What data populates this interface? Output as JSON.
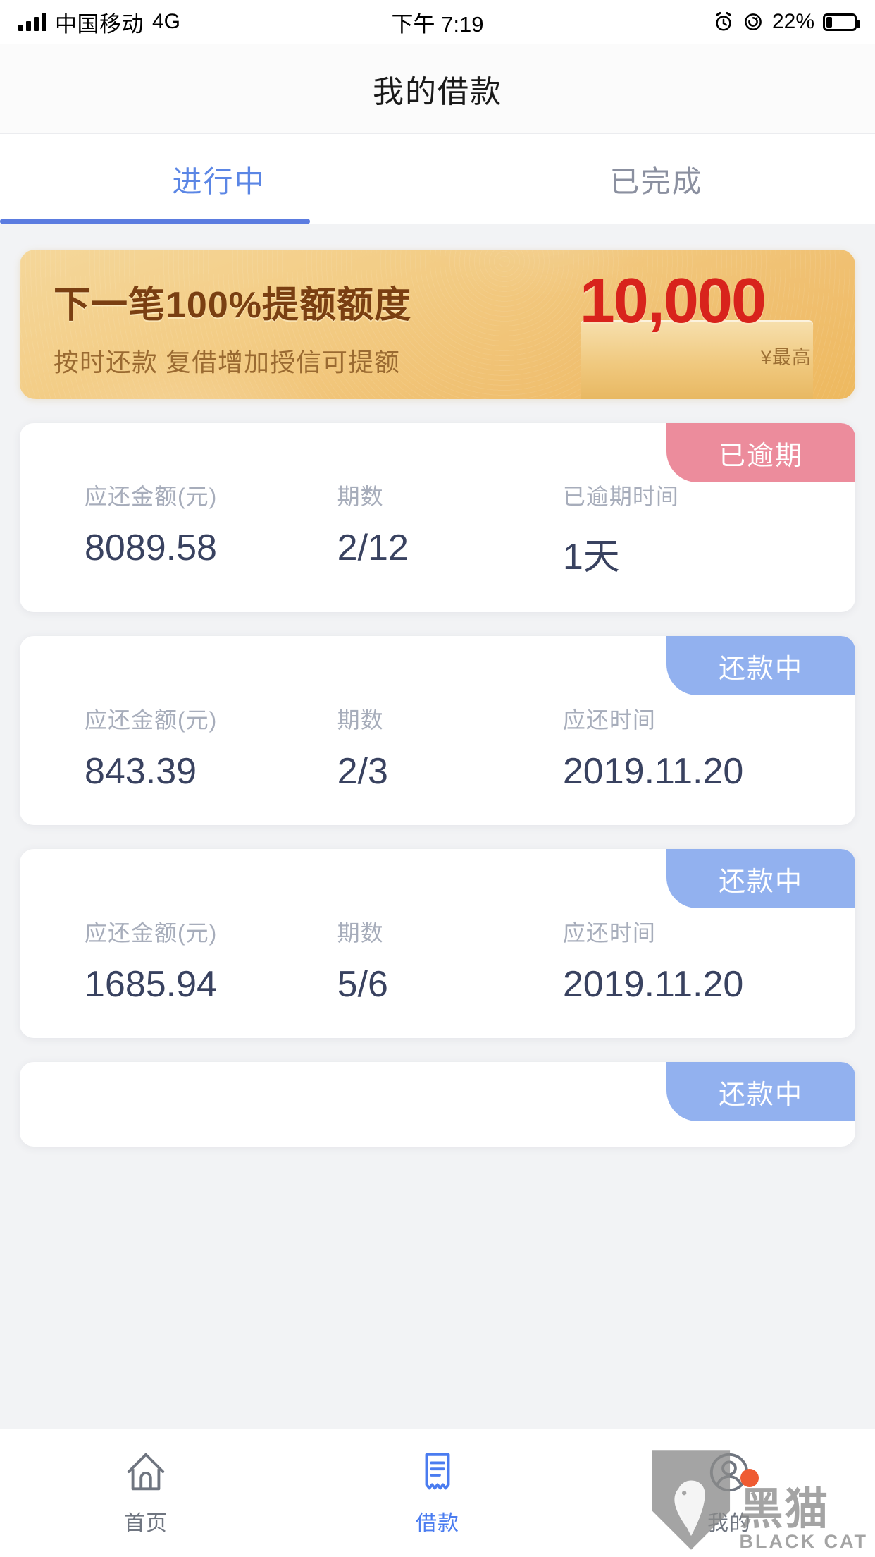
{
  "status_bar": {
    "carrier": "中国移动",
    "network": "4G",
    "time": "下午 7:19",
    "battery_percent": "22%",
    "icons": [
      "signal-icon",
      "alarm-icon",
      "rotation-lock-icon",
      "battery-icon"
    ]
  },
  "header": {
    "title": "我的借款"
  },
  "tabs": {
    "items": [
      {
        "label": "进行中",
        "active": true
      },
      {
        "label": "已完成",
        "active": false
      }
    ],
    "active_color": "#5b7ce0"
  },
  "banner": {
    "title": "下一笔100%提额额度",
    "subtitle": "按时还款  复借增加授信可提额",
    "amount": "10,000",
    "amount_note": "¥最高",
    "amount_color": "#d8231c"
  },
  "loans": [
    {
      "status": "已逾期",
      "status_type": "overdue",
      "status_color": "#ec8c9c",
      "fields": [
        {
          "label": "应还金额(元)",
          "value": "8089.58"
        },
        {
          "label": "期数",
          "value": "2/12"
        },
        {
          "label": "已逾期时间",
          "value": "1天"
        }
      ]
    },
    {
      "status": "还款中",
      "status_type": "repaying",
      "status_color": "#92b1ef",
      "fields": [
        {
          "label": "应还金额(元)",
          "value": "843.39"
        },
        {
          "label": "期数",
          "value": "2/3"
        },
        {
          "label": "应还时间",
          "value": "2019.11.20"
        }
      ]
    },
    {
      "status": "还款中",
      "status_type": "repaying",
      "status_color": "#92b1ef",
      "fields": [
        {
          "label": "应还金额(元)",
          "value": "1685.94"
        },
        {
          "label": "期数",
          "value": "5/6"
        },
        {
          "label": "应还时间",
          "value": "2019.11.20"
        }
      ]
    },
    {
      "status": "还款中",
      "status_type": "repaying",
      "status_color": "#92b1ef",
      "partial": true,
      "fields": []
    }
  ],
  "bottom_nav": {
    "items": [
      {
        "label": "首页",
        "icon": "home-icon",
        "active": false,
        "badge": false
      },
      {
        "label": "借款",
        "icon": "receipt-icon",
        "active": true,
        "badge": false
      },
      {
        "label": "我的",
        "icon": "person-icon",
        "active": false,
        "badge": true
      }
    ],
    "active_color": "#4a7cf0"
  },
  "watermark": {
    "cn": "黑猫",
    "en": "BLACK CAT"
  }
}
